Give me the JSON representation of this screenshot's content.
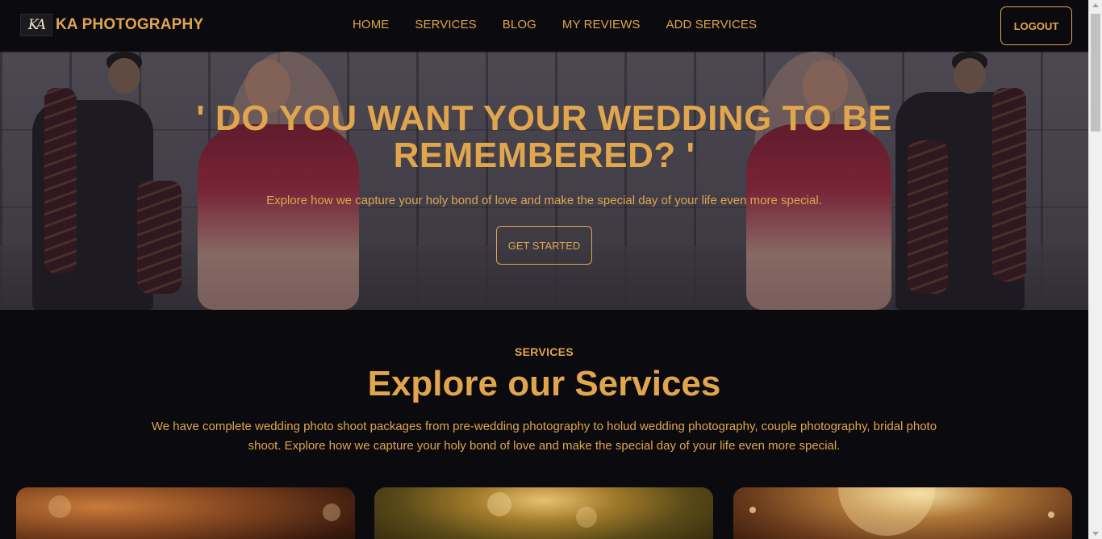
{
  "navbar": {
    "logo_text": "KA",
    "brand": "KA PHOTOGRAPHY",
    "links": [
      "HOME",
      "SERVICES",
      "BLOG",
      "MY REVIEWS",
      "ADD SERVICES"
    ],
    "logout": "LOGOUT"
  },
  "hero": {
    "title_line1": "' DO YOU WANT YOUR WEDDING TO BE",
    "title_line2": "REMEMBERED? '",
    "subtitle": "Explore how we capture your holy bond of love and make the special day of your life even more special.",
    "cta": "GET STARTED"
  },
  "services": {
    "eyebrow": "SERVICES",
    "title": "Explore our Services",
    "description": "We have complete wedding photo shoot packages from pre-wedding photography to holud wedding photography, couple photography, bridal photo shoot. Explore how we capture your holy bond of love and make the special day of your life even more special."
  },
  "colors": {
    "accent": "#e0a54d",
    "background": "#0b0a0e"
  }
}
